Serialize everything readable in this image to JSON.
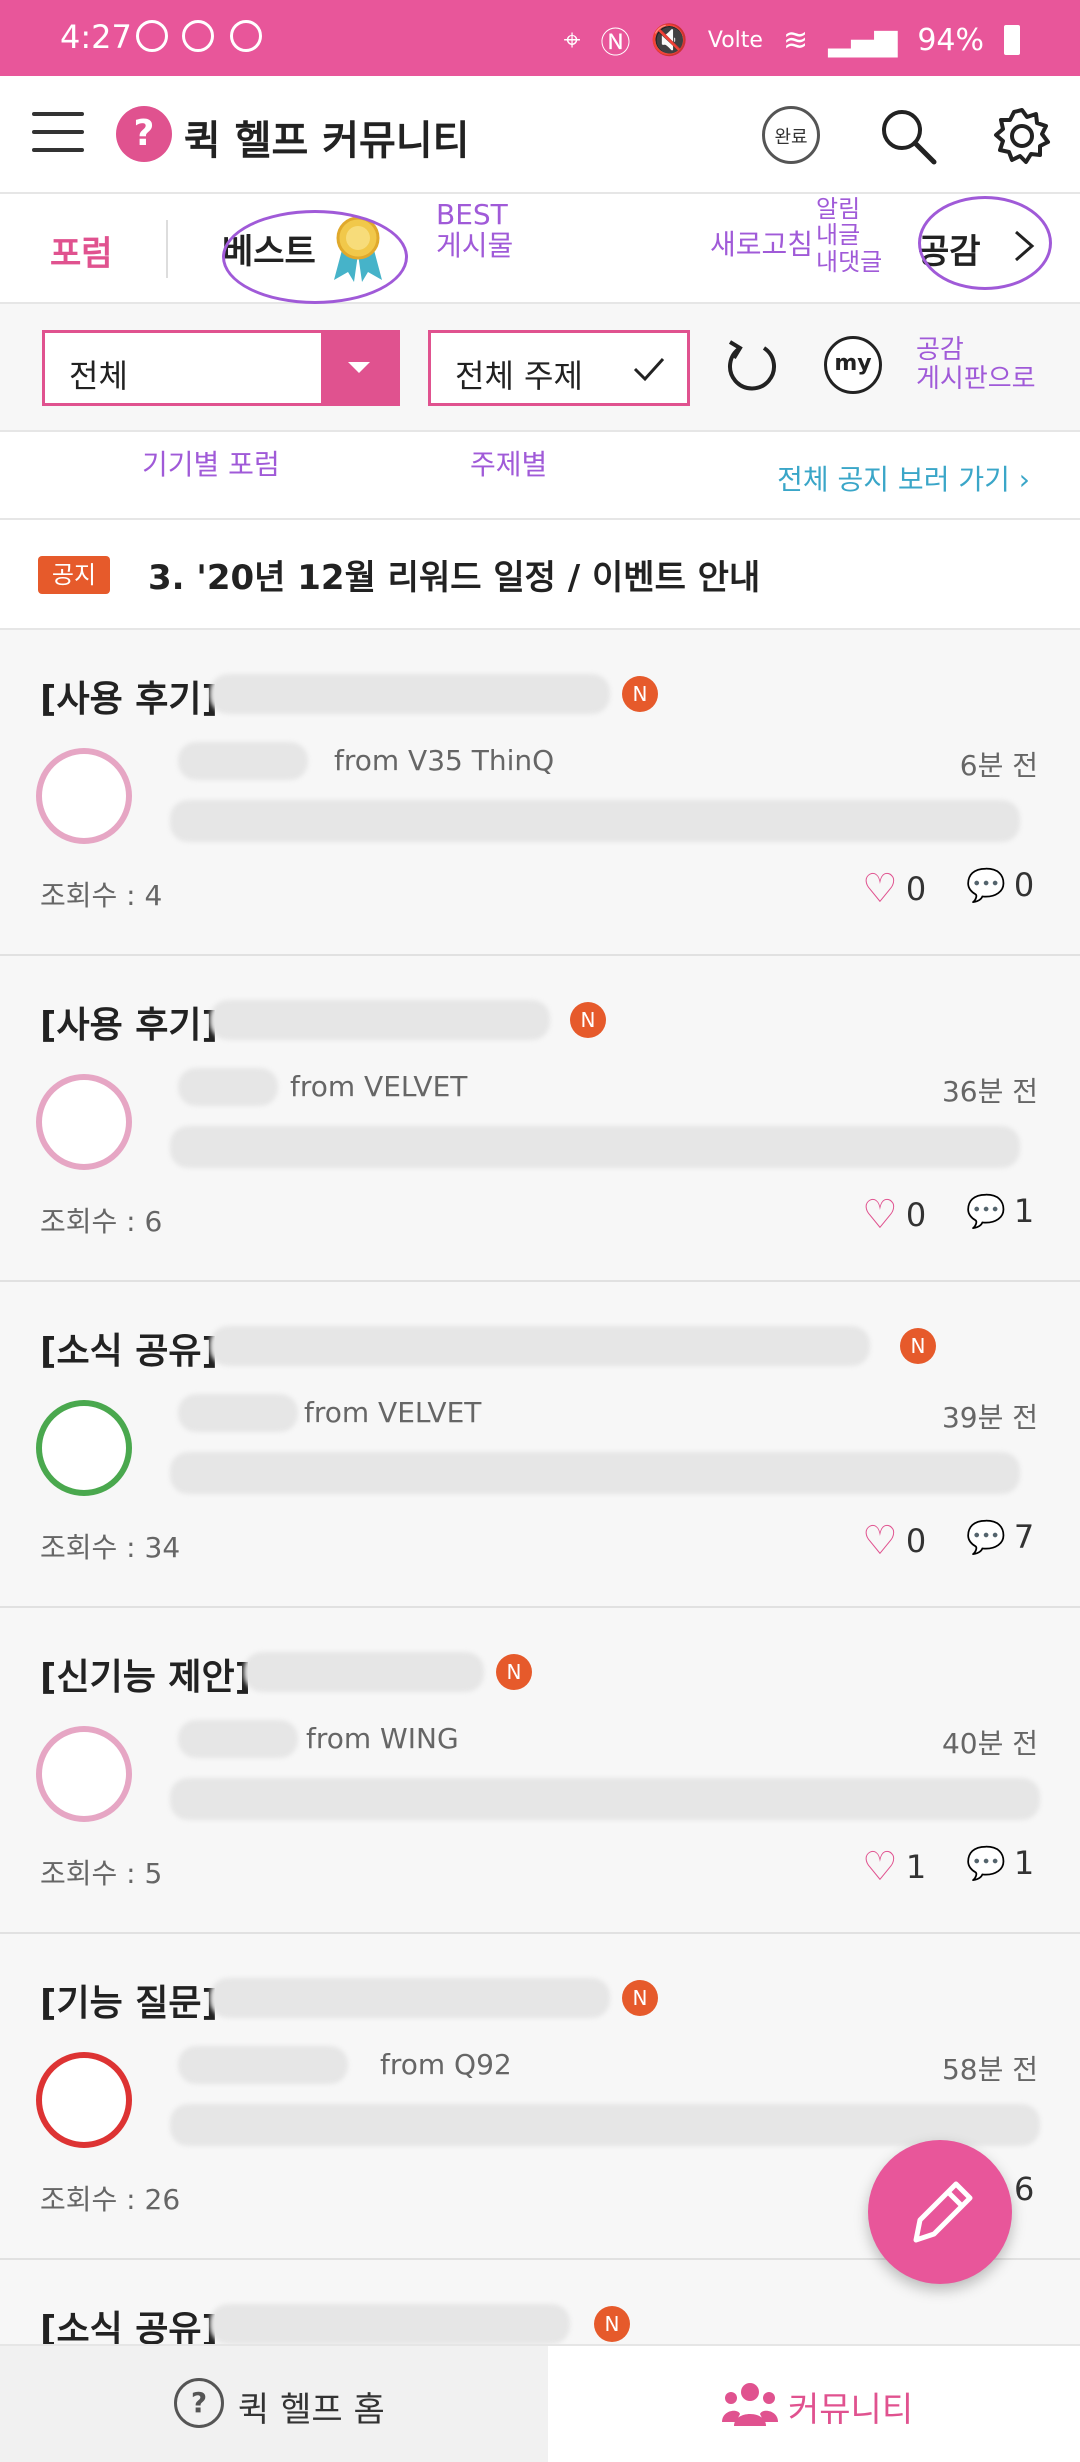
{
  "status_bar": {
    "time": "4:27",
    "battery": "94%"
  },
  "app_bar": {
    "logo": "?",
    "title": "퀵 헬프 커뮤니티",
    "done_label": "완료"
  },
  "tabs": {
    "forum": "포럼",
    "best": "베스트",
    "empathy": "공감"
  },
  "filters": {
    "device": "전체",
    "topic": "전체 주제",
    "my": "my"
  },
  "notice_link": "전체 공지 보러 가기",
  "notice": {
    "badge": "공지",
    "title": "3. '20년 12월 리워드 일정 / 이벤트 안내"
  },
  "annotations": {
    "best": "BEST\n게시물",
    "refresh": "새로고침",
    "my_posts": "알림\n내글\n내댓글",
    "empathy": "공감\n게시판으로",
    "device_forum": "기기별 포럼",
    "topic": "주제별"
  },
  "posts": [
    {
      "tag": "[사용 후기]",
      "from": "from V35 ThinQ",
      "time": "6분 전",
      "views": "조회수 : 4",
      "likes": "0",
      "comments": "0"
    },
    {
      "tag": "[사용 후기]",
      "from": "from VELVET",
      "time": "36분 전",
      "views": "조회수 : 6",
      "likes": "0",
      "comments": "1"
    },
    {
      "tag": "[소식 공유]",
      "from": "from VELVET",
      "time": "39분 전",
      "views": "조회수 : 34",
      "likes": "0",
      "comments": "7"
    },
    {
      "tag": "[신기능 제안]",
      "from": "from WING",
      "time": "40분 전",
      "views": "조회수 : 5",
      "likes": "1",
      "comments": "1"
    },
    {
      "tag": "[기능 질문]",
      "from": "from Q92",
      "time": "58분 전",
      "views": "조회수 : 26",
      "likes": "",
      "comments": "6"
    },
    {
      "tag": "[소식 공유]"
    }
  ],
  "bottom_nav": {
    "home": "퀵 헬프 홈",
    "community": "커뮤니티"
  },
  "colors": {
    "accent": "#e0528f",
    "notice_badge": "#e65a2b",
    "link": "#3aa6c8",
    "annotation": "#a05ad8"
  }
}
